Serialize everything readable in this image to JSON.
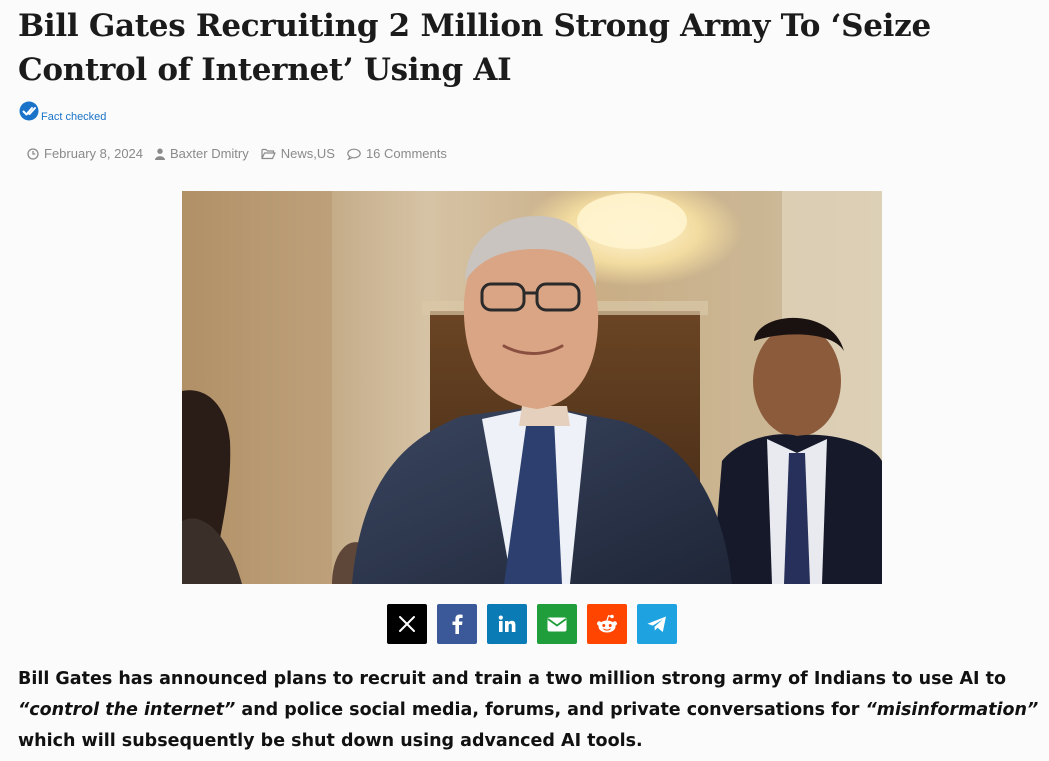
{
  "article": {
    "title": "Bill Gates Recruiting 2 Million Strong Army To ‘Seize Control of Internet’ Using AI",
    "fact_checked_label": "Fact checked",
    "meta": {
      "date": "February 8, 2024",
      "author": "Baxter Dmitry",
      "category_1": "News",
      "category_separator": ", ",
      "category_2": "US",
      "comments": "16 Comments"
    },
    "share_buttons": [
      {
        "network": "X",
        "icon": "x-icon",
        "color": "#000000"
      },
      {
        "network": "Facebook",
        "icon": "facebook-icon",
        "color": "#3b5998"
      },
      {
        "network": "LinkedIn",
        "icon": "linkedin-icon",
        "color": "#0a7bb5"
      },
      {
        "network": "Email",
        "icon": "envelope-icon",
        "color": "#1f9e3b"
      },
      {
        "network": "Reddit",
        "icon": "reddit-icon",
        "color": "#ff4500"
      },
      {
        "network": "Telegram",
        "icon": "telegram-icon",
        "color": "#1fa3e0"
      }
    ],
    "lead": {
      "part1": "Bill Gates has announced plans to recruit and train a two million strong army of Indians to use AI to ",
      "quote1": "“control the internet”",
      "part2": " and police social media, forums, and private conversations for ",
      "quote2": "“misinformation”",
      "part3": " which will subsequently be shut down using advanced AI tools."
    }
  }
}
